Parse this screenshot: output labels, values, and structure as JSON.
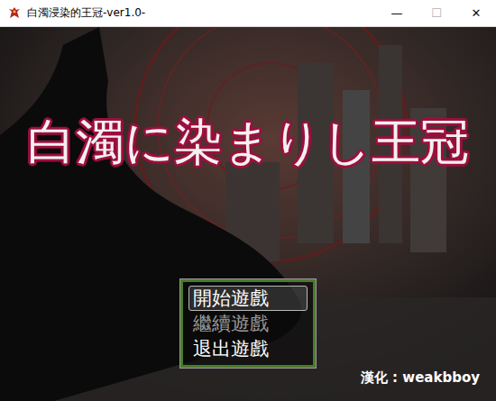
{
  "window": {
    "title": "白濁浸染的王冠-ver1.0-",
    "controls": [
      {
        "label": "—",
        "disabled": false
      },
      {
        "label": "☐",
        "disabled": true
      },
      {
        "label": "✕",
        "disabled": false
      }
    ]
  },
  "game": {
    "title": "白濁に染まりし王冠",
    "menu": [
      {
        "label": "開始遊戲",
        "selected": true,
        "disabled": false
      },
      {
        "label": "繼續遊戲",
        "selected": false,
        "disabled": true
      },
      {
        "label": "退出遊戲",
        "selected": false,
        "disabled": false
      }
    ],
    "credit": "漢化 : weakbboy"
  }
}
